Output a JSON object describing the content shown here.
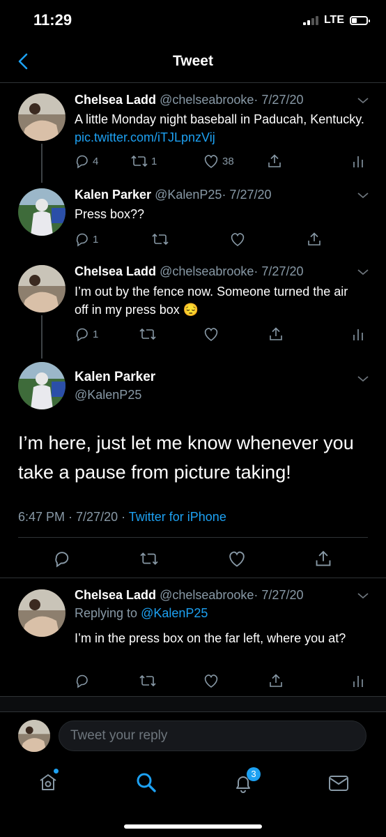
{
  "status": {
    "time": "11:29",
    "network": "LTE"
  },
  "nav": {
    "title": "Tweet"
  },
  "tweets": [
    {
      "name": "Chelsea Ladd",
      "handle": "@chelseabrooke",
      "date": "· 7/27/20",
      "text": "A little Monday night baseball in Paducah, Kentucky. ",
      "link": "pic.twitter.com/iTJLpnzVij",
      "replies": "4",
      "retweets": "1",
      "likes": "38"
    },
    {
      "name": "Kalen Parker",
      "handle": "@KalenP25",
      "date": "· 7/27/20",
      "text": "Press box??",
      "replies": "1"
    },
    {
      "name": "Chelsea Ladd",
      "handle": "@chelseabrooke",
      "date": "· 7/27/20",
      "text": "I’m out by the fence now. Someone turned the air off in my press box 😔",
      "replies": "1"
    }
  ],
  "main_tweet": {
    "name": "Kalen Parker",
    "handle": "@KalenP25",
    "text": "I’m here, just let me know whenever you take a pause from picture taking!",
    "time": "6:47 PM · 7/27/20 · ",
    "source": "Twitter for iPhone"
  },
  "reply_tweet": {
    "name": "Chelsea Ladd",
    "handle": "@chelseabrooke",
    "date": "· 7/27/20",
    "replying_prefix": "Replying to ",
    "replying_to": "@KalenP25",
    "text": "I’m in the press box on the far left, where you at?"
  },
  "composer": {
    "placeholder": "Tweet your reply"
  },
  "tabbar": {
    "notifications_badge": "3"
  },
  "colors": {
    "accent": "#1da1f2",
    "muted": "#8899a6",
    "background": "#000000"
  }
}
